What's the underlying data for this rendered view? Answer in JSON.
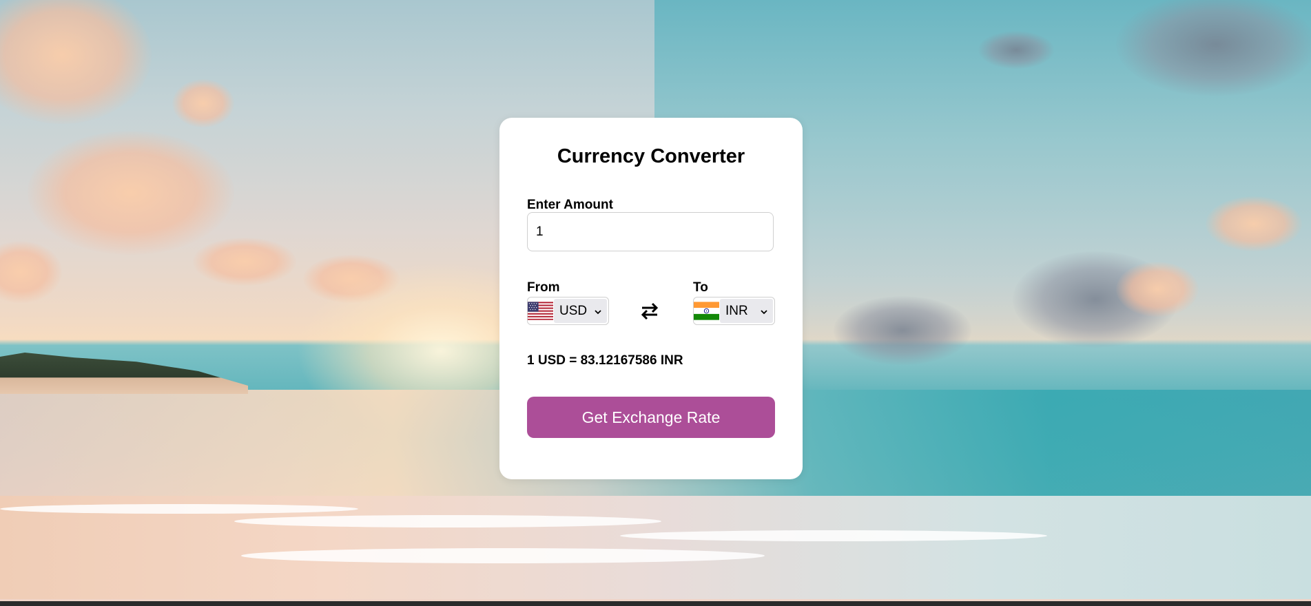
{
  "card": {
    "title": "Currency Converter",
    "amount_label": "Enter Amount",
    "amount_value": "1",
    "from_label": "From",
    "to_label": "To",
    "from_currency": "USD",
    "to_currency": "INR",
    "from_flag_icon": "us-flag-icon",
    "to_flag_icon": "india-flag-icon",
    "swap_icon": "swap-arrows-icon",
    "result_text": "1 USD = 83.12167586 INR",
    "button_label": "Get Exchange Rate"
  },
  "colors": {
    "button_bg": "#ac4e98",
    "button_text": "#ffffff",
    "card_bg": "#ffffff"
  }
}
